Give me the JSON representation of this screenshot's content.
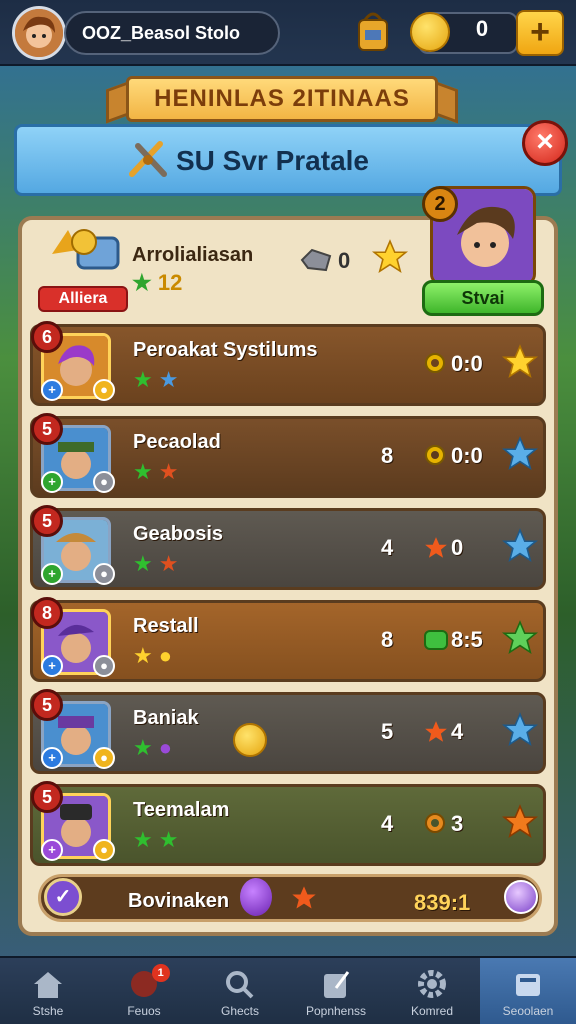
{
  "player": {
    "name": "OOZ_Beasol Stolo",
    "coins": "0"
  },
  "banner": {
    "title": "HENINLAS 2ITINAAS"
  },
  "header": {
    "title": "SU Svr Pratale"
  },
  "hero": {
    "name": "Arrolialiasan",
    "stars": "12",
    "badge": "Alliera",
    "count": "0"
  },
  "featured": {
    "rank": "2",
    "button": "Stvai"
  },
  "rows": [
    {
      "rank": "6",
      "name": "Peroakat Systilums",
      "count": "",
      "score": "0:0"
    },
    {
      "rank": "5",
      "name": "Pecaolad",
      "count": "8",
      "score": "0:0"
    },
    {
      "rank": "5",
      "name": "Geabosis",
      "count": "4",
      "score": "0"
    },
    {
      "rank": "8",
      "name": "Restall",
      "count": "8",
      "score": "8:5"
    },
    {
      "rank": "5",
      "name": "Baniak",
      "count": "5",
      "score": "4"
    },
    {
      "rank": "5",
      "name": "Teemalam",
      "count": "4",
      "score": "3"
    }
  ],
  "footer": {
    "label": "Bovinaken",
    "score": "839:1"
  },
  "nav": [
    {
      "label": "Stshe"
    },
    {
      "label": "Feuos",
      "badge": "1"
    },
    {
      "label": "Ghects"
    },
    {
      "label": "Popnhenss"
    },
    {
      "label": "Komred"
    },
    {
      "label": "Seoolaen"
    }
  ]
}
